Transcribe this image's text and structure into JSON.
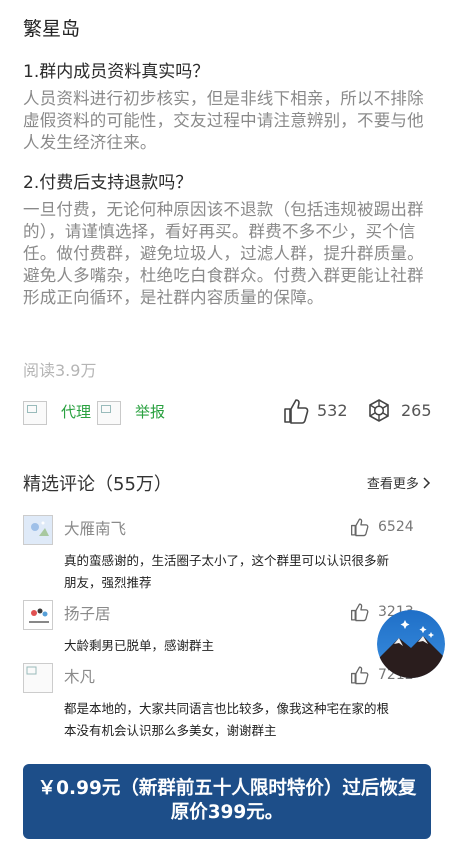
{
  "page": {
    "title": "繁星岛"
  },
  "faq": [
    {
      "question": "1.群内成员资料真实吗？",
      "answer": "人员资料进行初步核实，但是非线下相亲，所以不排除虚假资料的可能性，交友过程中请注意辨别，不要与他人发生经济往来。"
    },
    {
      "question": "2.付费后支持退款吗？",
      "answer": "一旦付费，无论何种原因该不退款（包括违规被踢出群的），请谨慎选择，看好再买。群费不多不少，买个信任。做付费群，避免垃圾人，过滤人群，提升群质量。避免人多嘴杂，杜绝吃白食群众。付费入群更能让社群形成正向循环，是社群内容质量的保障。"
    }
  ],
  "stats": {
    "read_label": "阅读3.9万",
    "agent_label": "代理",
    "report_label": "举报",
    "likes": "532",
    "shares": "265"
  },
  "comments_section": {
    "title": "精选评论（55万）",
    "more_label": "查看更多"
  },
  "comments": [
    {
      "name": "大雁南飞",
      "likes": "6524",
      "text": "真的蛮感谢的，生活圈子太小了，这个群里可以认识很多新朋友，强烈推荐"
    },
    {
      "name": "扬子居",
      "likes": "3213",
      "text": "大龄剩男已脱单，感谢群主"
    },
    {
      "name": "木凡",
      "likes": "7212",
      "text": "都是本地的，大家共同语言也比较多，像我这种宅在家的根本没有机会认识那么多美女，谢谢群主"
    }
  ],
  "cta": {
    "label": "￥0.99元（新群前五十人限时特价）过后恢复原价399元。"
  },
  "colors": {
    "accent_green": "#2aa140",
    "cta_blue": "#1d4e89",
    "muted_text": "#8a8a8a"
  },
  "icons": [
    "thumbs-up-icon",
    "share-hexagon-icon",
    "chevron-right-icon",
    "mountain-stars-badge-icon",
    "broken-image-icon"
  ]
}
